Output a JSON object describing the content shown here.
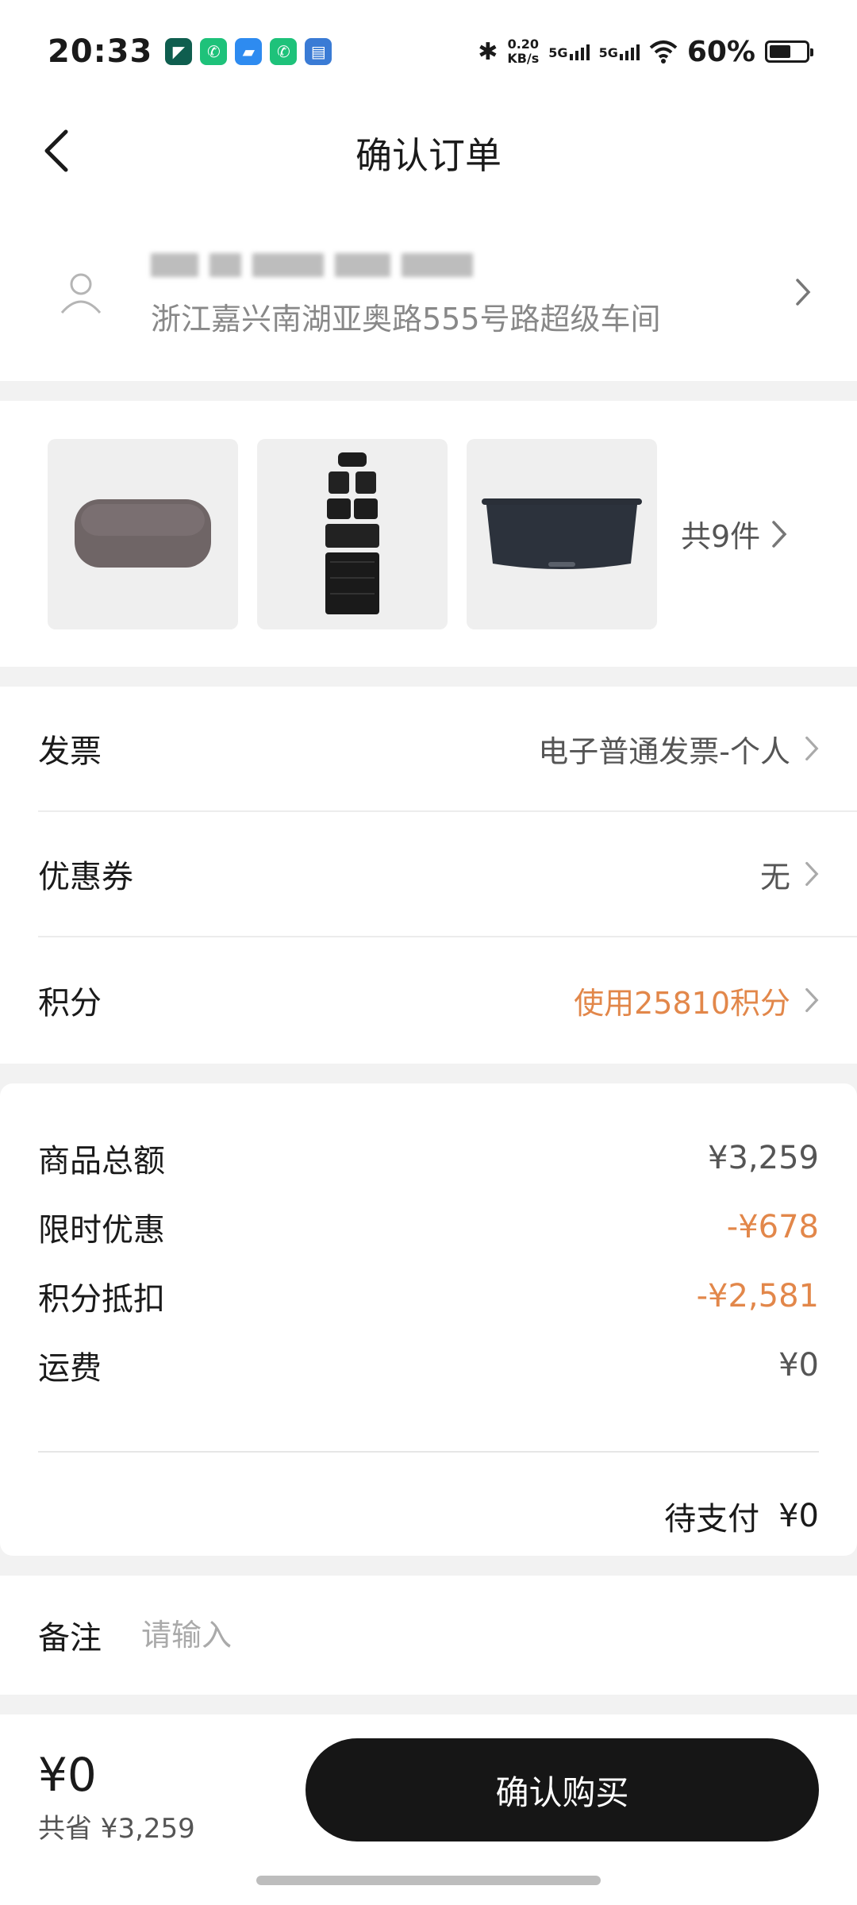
{
  "status_bar": {
    "time": "20:33",
    "net_speed_value": "0.20",
    "net_speed_unit": "KB/s",
    "signal1": "5G",
    "signal2": "5G",
    "battery": "60%",
    "battery_level": 0.6,
    "app_icons": [
      "app-icon-1",
      "phone-icon",
      "chat-icon",
      "phone-icon",
      "message-icon"
    ]
  },
  "header": {
    "title": "确认订单"
  },
  "address": {
    "line": "浙江嘉兴南湖亚奥路555号路超级车间"
  },
  "products": {
    "count_label": "共9件"
  },
  "options": {
    "invoice": {
      "label": "发票",
      "value": "电子普通发票-个人"
    },
    "coupon": {
      "label": "优惠券",
      "value": "无"
    },
    "points": {
      "label": "积分",
      "value": "使用25810积分"
    }
  },
  "summary": {
    "rows": [
      {
        "label": "商品总额",
        "amount": "¥3,259"
      },
      {
        "label": "限时优惠",
        "amount": "-¥678"
      },
      {
        "label": "积分抵扣",
        "amount": "-¥2,581"
      },
      {
        "label": "运费",
        "amount": "¥0"
      }
    ],
    "due_label": "待支付",
    "due_amount": "¥0"
  },
  "remark": {
    "label": "备注",
    "placeholder": "请输入",
    "value": ""
  },
  "bottom_bar": {
    "total": "¥0",
    "savings": "共省 ¥3,259",
    "buy_label": "确认购买"
  },
  "colors": {
    "accent_orange": "#e2874a",
    "button_dark": "#161616"
  }
}
